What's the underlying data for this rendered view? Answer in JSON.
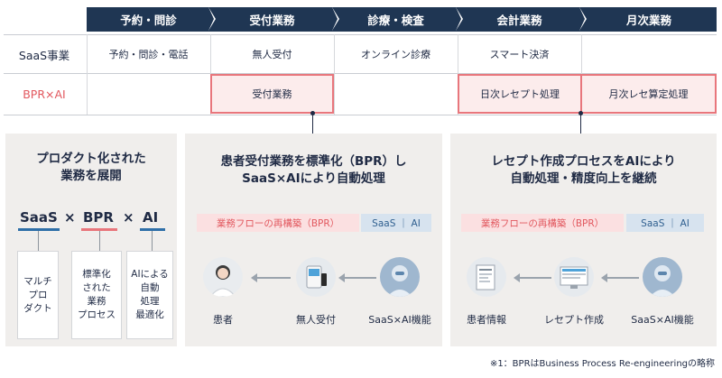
{
  "header": {
    "steps": [
      "予約・問診",
      "受付業務",
      "診療・検査",
      "会計業務",
      "月次業務"
    ]
  },
  "rows": {
    "saas": {
      "label": "SaaS事業",
      "cells": [
        "予約・問診・電話",
        "無人受付",
        "オンライン診療",
        "スマート決済",
        ""
      ]
    },
    "bpr": {
      "label": "BPR×AI",
      "cells": [
        "",
        "受付業務",
        "",
        "日次レセプト処理",
        "月次レセ算定処理"
      ]
    }
  },
  "panel_left": {
    "title_line1": "プロダクト化された",
    "title_line2": "業務を展開",
    "formula": {
      "t1": "SaaS",
      "op1": "×",
      "t2": "BPR",
      "op2": "×",
      "t3": "AI"
    },
    "boxes": [
      [
        "マルチ",
        "プロ",
        "ダクト"
      ],
      [
        "標準化",
        "された",
        "業務",
        "プロセス"
      ],
      [
        "AIによる",
        "自動",
        "処理",
        "最適化"
      ]
    ]
  },
  "panel_mid": {
    "title_line1": "患者受付業務を標準化（BPR）し",
    "title_line2": "SaaS×AIにより自動処理",
    "tag_pink": "業務フローの再構築（BPR）",
    "tag_blue": "SaaS ｜ AI",
    "items": [
      "患者",
      "無人受付",
      "SaaS×AI機能"
    ]
  },
  "panel_right": {
    "title_line1": "レセプト作成プロセスをAIにより",
    "title_line2": "自動処理・精度向上を継続",
    "tag_pink": "業務フローの再構築（BPR）",
    "tag_blue": "SaaS ｜ AI",
    "items": [
      "患者情報",
      "レセプト作成",
      "SaaS×AI機能"
    ]
  },
  "footnote": "※1：BPRはBusiness Process Re-engineeringの略称",
  "colors": {
    "navy": "#1f3653",
    "red": "#e8767c",
    "blue": "#2f6fa8",
    "panel": "#f0eeec"
  }
}
